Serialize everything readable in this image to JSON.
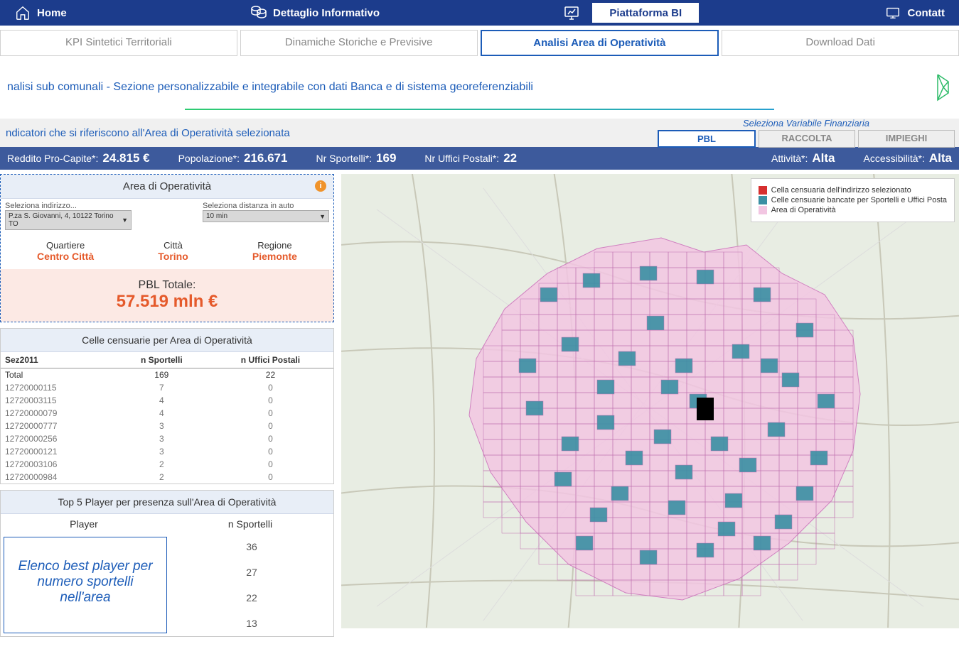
{
  "topnav": {
    "home": "Home",
    "detail": "Dettaglio Informativo",
    "bi": "Piattaforma BI",
    "contact": "Contatt"
  },
  "subtabs": [
    "KPI Sintetici Territoriali",
    "Dinamiche Storiche e Previsive",
    "Analisi Area di Operatività",
    "Download Dati"
  ],
  "subtitle": "nalisi sub comunali - Sezione personalizzabile e integrabile con dati Banca e di sistema georeferenziabili",
  "indicator_label": "ndicatori che si riferiscono all'Area di Operatività selezionata",
  "var_fin": {
    "label": "Seleziona Variabile Finanziaria",
    "tabs": [
      "PBL",
      "RACCOLTA",
      "IMPIEGHI"
    ]
  },
  "kpis": {
    "reddito": {
      "lab": "Reddito Pro-Capite*:",
      "val": "24.815 €"
    },
    "pop": {
      "lab": "Popolazione*:",
      "val": "216.671"
    },
    "sportelli": {
      "lab": "Nr Sportelli*:",
      "val": "169"
    },
    "uffici": {
      "lab": "Nr Uffici Postali*:",
      "val": "22"
    },
    "attivita": {
      "lab": "Attività*:",
      "val": "Alta"
    },
    "access": {
      "lab": "Accessibilità*:",
      "val": "Alta"
    }
  },
  "area_panel": {
    "title": "Area di Operatività",
    "sel_addr_lab": "Seleziona indirizzo...",
    "sel_addr_val": "P.za S. Giovanni, 4, 10122 Torino TO",
    "sel_dist_lab": "Seleziona distanza in auto",
    "sel_dist_val": "10 min",
    "quart_lab": "Quartiere",
    "quart_val": "Centro Città",
    "citta_lab": "Città",
    "citta_val": "Torino",
    "reg_lab": "Regione",
    "reg_val": "Piemonte",
    "pbl_lab": "PBL Totale:",
    "pbl_val": "57.519 mln €"
  },
  "celle_panel": {
    "title": "Celle censuarie per Area di Operatività",
    "cols": [
      "Sez2011",
      "n Sportelli",
      "n Uffici Postali"
    ],
    "rows": [
      [
        "Total",
        "169",
        "22"
      ],
      [
        "12720000115",
        "7",
        "0"
      ],
      [
        "12720003115",
        "4",
        "0"
      ],
      [
        "12720000079",
        "4",
        "0"
      ],
      [
        "12720000777",
        "3",
        "0"
      ],
      [
        "12720000256",
        "3",
        "0"
      ],
      [
        "12720000121",
        "3",
        "0"
      ],
      [
        "12720003106",
        "2",
        "0"
      ],
      [
        "12720000984",
        "2",
        "0"
      ]
    ]
  },
  "players_panel": {
    "title": "Top 5 Player per presenza sull'Area di Operatività",
    "col_player": "Player",
    "col_sport": "n Sportelli",
    "note": "Elenco best player per numero sportelli nell'area",
    "vals": [
      "36",
      "27",
      "22",
      "13"
    ]
  },
  "map_legend": {
    "item1": "Cella censuaria dell'indirizzo selezionato",
    "item2": "Celle censuarie bancate per Sportelli e Uffici Posta",
    "item3": "Area di Operatività"
  }
}
